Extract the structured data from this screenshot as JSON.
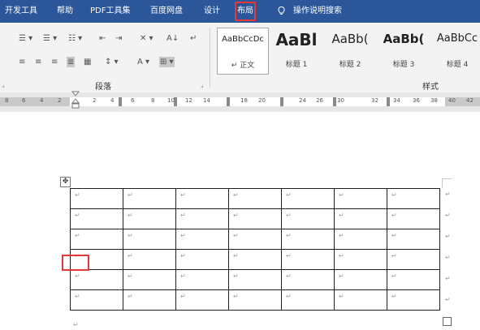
{
  "tabs": [
    {
      "label": "开发工具",
      "highlighted": false
    },
    {
      "label": "帮助",
      "highlighted": false
    },
    {
      "label": "PDF工具集",
      "highlighted": false
    },
    {
      "label": "百度网盘",
      "highlighted": false
    },
    {
      "label": "设计",
      "highlighted": false
    },
    {
      "label": "布局",
      "highlighted": true
    }
  ],
  "tell_me": "操作说明搜索",
  "paragraph_group": {
    "label": "段落",
    "row1": [
      "☰ ▾",
      "☰ ▾",
      "☷ ▾",
      "⇤",
      "⇥",
      "✕ ▾",
      "A↓",
      "↵"
    ],
    "row2": [
      "≡",
      "≡",
      "≡",
      "≣",
      "▦",
      "↕ ▾",
      "A ▾",
      "⊞ ▾"
    ]
  },
  "styles_group": {
    "label": "样式",
    "items": [
      {
        "preview": "AaBbCcDc",
        "name": "↵ 正文"
      },
      {
        "preview": "AaBl",
        "name": "标题 1"
      },
      {
        "preview": "AaBb(",
        "name": "标题 2"
      },
      {
        "preview": "AaBb(",
        "name": "标题 3"
      },
      {
        "preview": "AaBbCc",
        "name": "标题 4"
      }
    ]
  },
  "ruler_numbers": [
    "8",
    "6",
    "4",
    "2",
    "2",
    "4",
    "6",
    "8",
    "10",
    "12",
    "14",
    "18",
    "20",
    "24",
    "26",
    "30",
    "32",
    "34",
    "36",
    "38",
    "40",
    "42"
  ],
  "table": {
    "rows": 6,
    "cols": 7,
    "cell_mark": "↵",
    "mover_symbol": "✥"
  },
  "colors": {
    "tabbar": "#2b579a",
    "highlight": "#e53935",
    "ribbon": "#f3f3f3",
    "ruler": "#e7e7e7"
  }
}
